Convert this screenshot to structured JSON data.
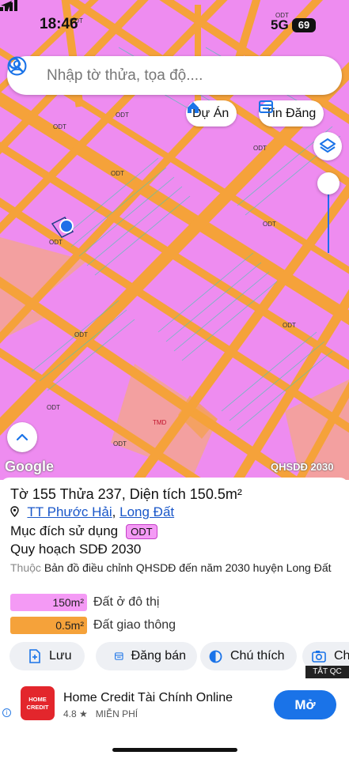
{
  "status_bar": {
    "time": "18:46",
    "network": "5G",
    "battery": "69"
  },
  "search": {
    "placeholder": "Nhập tờ thửa, tọa độ...."
  },
  "map_buttons": {
    "du_an": "Dự Án",
    "tin_dang": "Tin Đăng"
  },
  "map": {
    "zone_labels": [
      "ODT",
      "ODT",
      "ODT",
      "ODT",
      "ODT",
      "ODT",
      "ODT",
      "ODT",
      "ODT",
      "ODT",
      "ODT",
      "ODT",
      "TMD"
    ],
    "attribution": "Google",
    "layer_tag": "QHSDĐ 2030",
    "colors": {
      "residential": "#ee8cf0",
      "road": "#f5a23a",
      "commercial": "#f3a0a0",
      "location_dot": "#1f6fe8"
    }
  },
  "parcel": {
    "to_label": "Tờ",
    "to_number": "155",
    "thua_label": "Thửa",
    "thua_number": "237",
    "area_label": "Diện tích",
    "area_value": "150.5m²",
    "location_town": "TT Phước Hải",
    "location_district": "Long Đất",
    "purpose_label": "Mục đích sử dụng",
    "purpose_code": "ODT",
    "plan_label": "Quy hoạch SDĐ 2030",
    "belongs_label": "Thuộc",
    "belongs_value": "Bản đồ điều chỉnh QHSDĐ đến năm 2030 huyện Long Đất",
    "legend": [
      {
        "value": "150m²",
        "label": "Đất ở đô thị",
        "color": "#f49af5"
      },
      {
        "value": "0.5m²",
        "label": "Đất giao thông",
        "color": "#f5a23a"
      }
    ]
  },
  "actions": {
    "save": "Lưu",
    "post_sale": "Đăng bán",
    "legend": "Chú thích",
    "photo": "Ch"
  },
  "ad": {
    "hide_label": "TẮT QC",
    "logo_text": "HOME CREDIT",
    "title": "Home Credit Tài Chính Online",
    "rating": "4.8 ★",
    "price": "MIỄN PHÍ",
    "cta": "Mở",
    "info_icon_text": "i"
  }
}
